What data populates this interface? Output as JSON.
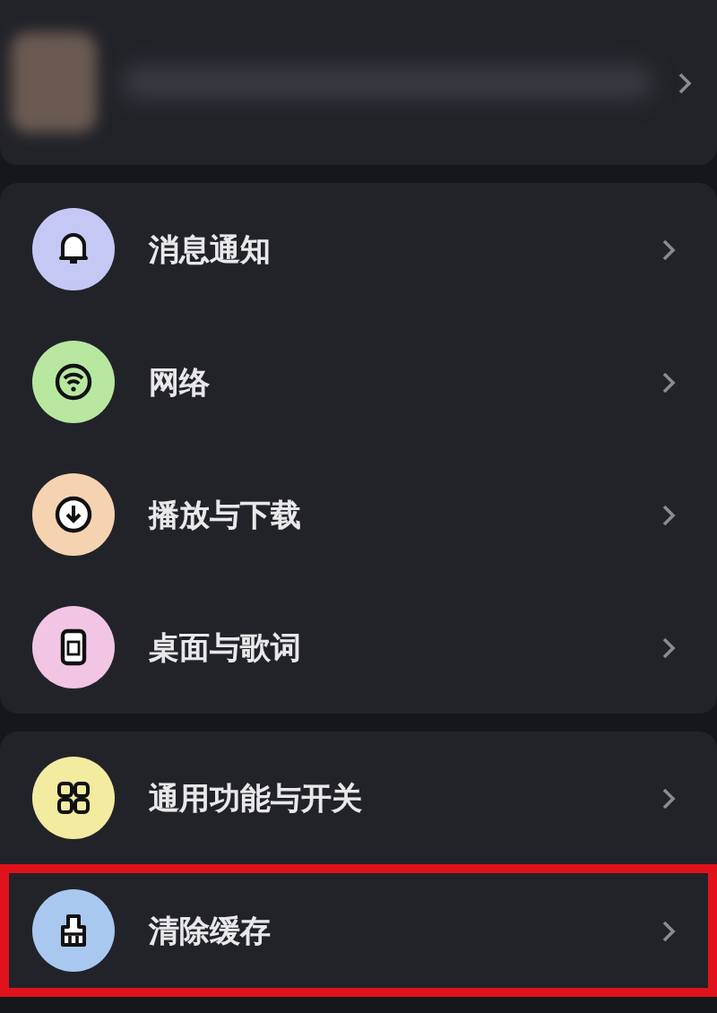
{
  "profile": {
    "blurred": true
  },
  "groups": [
    {
      "items": [
        {
          "label": "消息通知",
          "kind": "bell",
          "color": "#c5c8f5",
          "highlighted": false
        },
        {
          "label": "网络",
          "kind": "wifi",
          "color": "#b8e8a0",
          "highlighted": false
        },
        {
          "label": "播放与下载",
          "kind": "download",
          "color": "#f5d3b0",
          "highlighted": false
        },
        {
          "label": "桌面与歌词",
          "kind": "lyrics",
          "color": "#f2c5e4",
          "highlighted": false
        }
      ]
    },
    {
      "items": [
        {
          "label": "通用功能与开关",
          "kind": "grid",
          "color": "#f3eba0",
          "highlighted": false
        },
        {
          "label": "清除缓存",
          "kind": "broom",
          "color": "#a9c8f0",
          "highlighted": true
        }
      ]
    }
  ]
}
